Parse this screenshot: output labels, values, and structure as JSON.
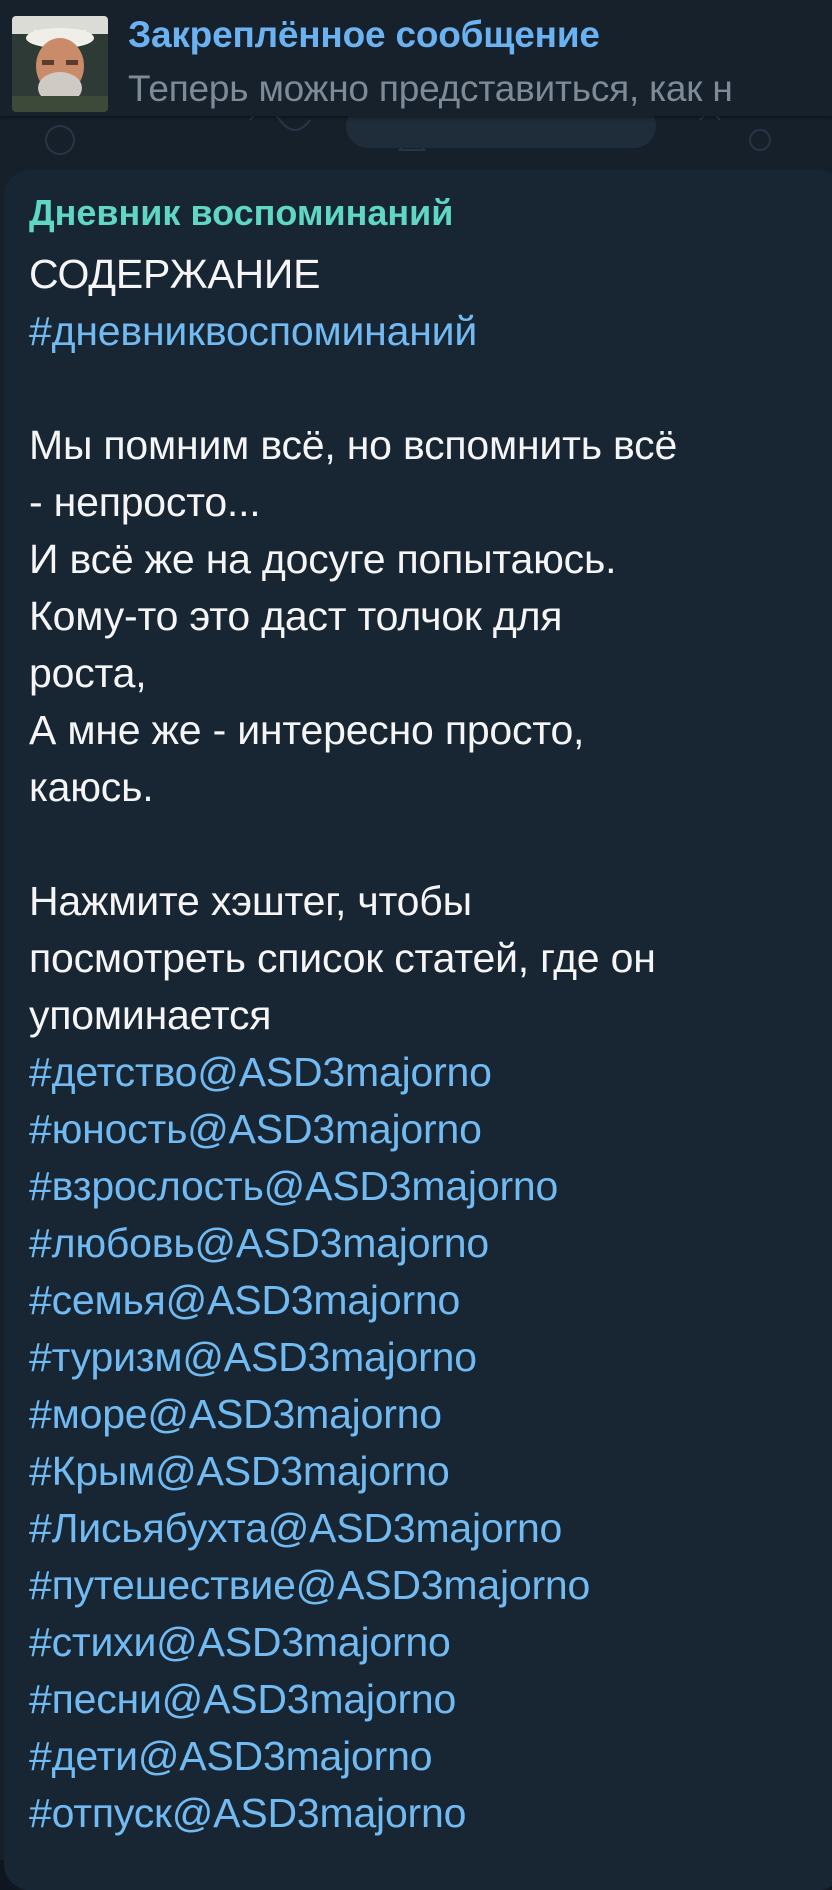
{
  "pinned": {
    "title": "Закреплённое сообщение",
    "text": "Теперь можно представиться, как н"
  },
  "message": {
    "sender": "Дневник воспоминаний",
    "heading": "СОДЕРЖАНИЕ",
    "top_tag": "#дневниквоспоминаний",
    "poem": [
      "Мы помним всё, но вспомнить всё",
      "- непросто...",
      "И всё же на досуге попытаюсь.",
      "Кому-то это даст толчок для",
      "роста,",
      "А мне же - интересно просто,",
      "каюсь."
    ],
    "instruction": [
      "Нажмите хэштег, чтобы",
      "посмотреть список статей, где он",
      "упоминается"
    ],
    "tags": [
      "#детство@ASD3majorno",
      "#юность@ASD3majorno",
      "#взрослость@ASD3majorno",
      "#любовь@ASD3majorno",
      "#семья@ASD3majorno",
      "#туризм@ASD3majorno",
      "#море@ASD3majorno",
      "#Крым@ASD3majorno",
      "#Лисьябухта@ASD3majorno",
      "#путешествие@ASD3majorno",
      "#стихи@ASD3majorno",
      "#песни@ASD3majorno",
      "#дети@ASD3majorno",
      "#отпуск@ASD3majorno"
    ]
  },
  "colors": {
    "background": "#0e1621",
    "bubble": "#182533",
    "pinned_title": "#6ab2f2",
    "sender_name": "#5fd7c4",
    "hashtag": "#71baf2",
    "text": "#f5f5f5"
  }
}
